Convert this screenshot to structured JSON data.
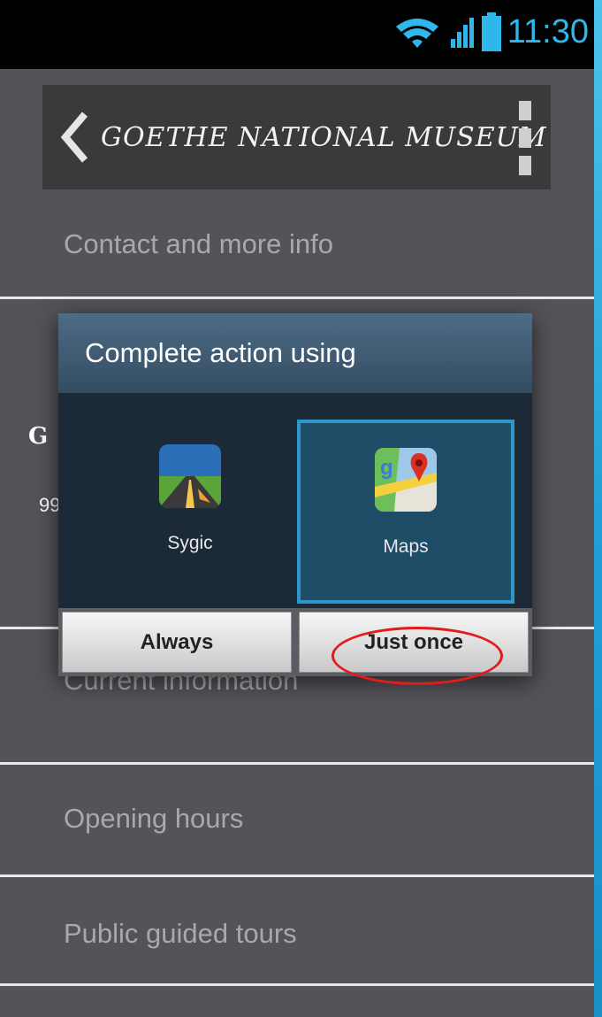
{
  "status_bar": {
    "time": "11:30",
    "accent_color": "#2fb7ec"
  },
  "action_bar": {
    "title": "GOETHE NATIONAL MUSEUM",
    "back_icon": "chevron-left-icon",
    "menu_icon": "overflow-menu-icon"
  },
  "list": {
    "contact": "Contact and more info",
    "partial_letter": "G",
    "partial_number": "99",
    "current": "Current information",
    "hours": "Opening hours",
    "tours": "Public guided tours"
  },
  "dialog": {
    "title": "Complete action using",
    "apps": [
      {
        "label": "Sygic",
        "icon": "sygic-icon",
        "selected": false
      },
      {
        "label": "Maps",
        "icon": "maps-icon",
        "selected": true
      }
    ],
    "buttons": {
      "always": "Always",
      "just_once": "Just once"
    },
    "highlight_color": "#e21b1b"
  }
}
